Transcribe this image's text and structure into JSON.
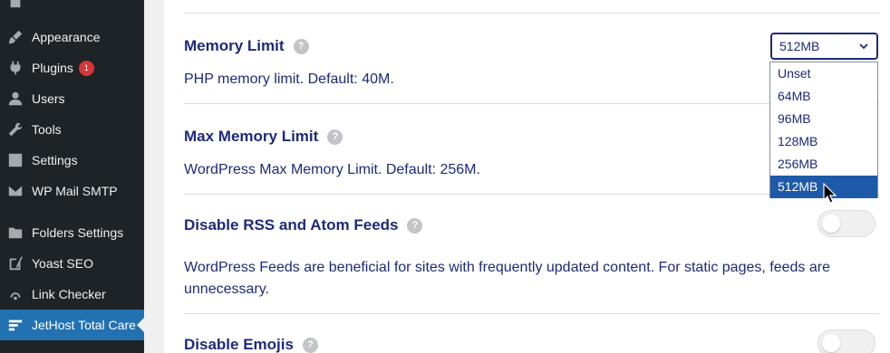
{
  "sidebar": {
    "items": [
      {
        "label": "Appearance",
        "icon": "paintbrush-icon"
      },
      {
        "label": "Plugins",
        "icon": "plugin-icon",
        "badge": "1"
      },
      {
        "label": "Users",
        "icon": "users-icon"
      },
      {
        "label": "Tools",
        "icon": "wrench-icon"
      },
      {
        "label": "Settings",
        "icon": "settings-sliders-icon"
      },
      {
        "label": "WP Mail SMTP",
        "icon": "mail-icon"
      },
      {
        "label": "Folders Settings",
        "icon": "folder-icon"
      },
      {
        "label": "Yoast SEO",
        "icon": "yoast-icon"
      },
      {
        "label": "Link Checker",
        "icon": "link-checker-icon"
      },
      {
        "label": "JetHost Total Care",
        "icon": "jethost-icon",
        "active": true
      }
    ]
  },
  "settings": {
    "memory_limit": {
      "title": "Memory Limit",
      "desc": "PHP memory limit. Default: 40M.",
      "selected": "512MB",
      "options": [
        "Unset",
        "64MB",
        "96MB",
        "128MB",
        "256MB",
        "512MB"
      ]
    },
    "max_memory_limit": {
      "title": "Max Memory Limit",
      "desc": "WordPress Max Memory Limit. Default: 256M."
    },
    "disable_rss": {
      "title": "Disable RSS and Atom Feeds",
      "desc": "WordPress Feeds are beneficial for sites with frequently updated content. For static pages, feeds are unnecessary.",
      "enabled": false
    },
    "disable_emojis": {
      "title": "Disable Emojis",
      "enabled": false
    }
  },
  "help_glyph": "?",
  "colors": {
    "sidebar_bg": "#1d2327",
    "active_bg": "#2271b1",
    "text_navy": "#1e2a78",
    "selected_option_bg": "#1e5aa8",
    "badge_red": "#d63638"
  }
}
